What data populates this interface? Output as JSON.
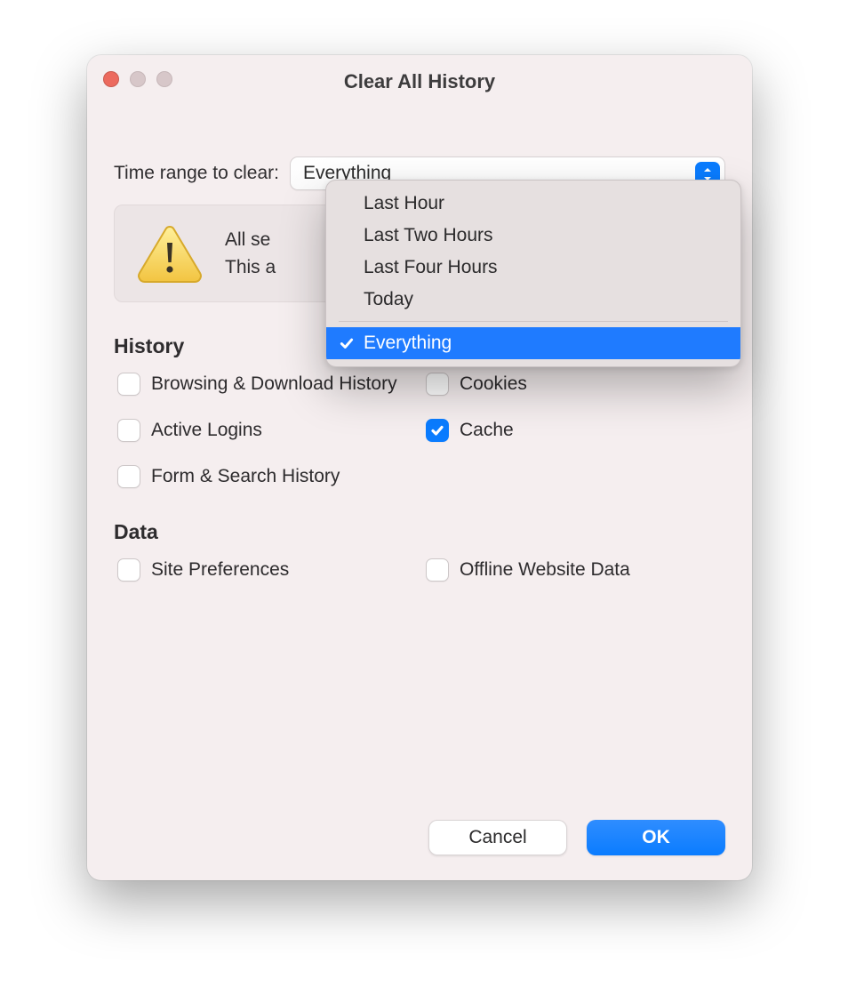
{
  "window": {
    "title": "Clear All History"
  },
  "range": {
    "label": "Time range to clear:",
    "selected": "Everything",
    "options": [
      "Last Hour",
      "Last Two Hours",
      "Last Four Hours",
      "Today",
      "Everything"
    ]
  },
  "warning": {
    "line1": "All se",
    "line2": "This a"
  },
  "sections": {
    "history": {
      "title": "History",
      "items": [
        {
          "label": "Browsing & Download History",
          "checked": false
        },
        {
          "label": "Cookies",
          "checked": false
        },
        {
          "label": "Active Logins",
          "checked": false
        },
        {
          "label": "Cache",
          "checked": true
        },
        {
          "label": "Form & Search History",
          "checked": false
        }
      ]
    },
    "data": {
      "title": "Data",
      "items": [
        {
          "label": "Site Preferences",
          "checked": false
        },
        {
          "label": "Offline Website Data",
          "checked": false
        }
      ]
    }
  },
  "buttons": {
    "cancel": "Cancel",
    "ok": "OK"
  }
}
